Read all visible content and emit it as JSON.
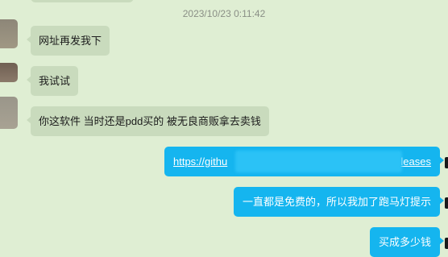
{
  "chat": {
    "timestamp": "2023/10/23 0:11:42",
    "messages": [
      {
        "side": "incoming",
        "text": "网址再发我下"
      },
      {
        "side": "incoming",
        "text": "我试试"
      },
      {
        "side": "incoming",
        "text": "你这软件 当时还是pdd买的 被无良商贩拿去卖钱"
      },
      {
        "side": "outgoing",
        "text": "https://github.com/releases",
        "link_prefix": "https://githu",
        "link_suffix": "leases"
      },
      {
        "side": "outgoing",
        "text": "一直都是免费的，所以我加了跑马灯提示"
      },
      {
        "side": "outgoing",
        "text": "买成多少钱"
      }
    ]
  },
  "colors": {
    "background": "#dfeed3",
    "incoming_bubble": "#c9dbbd",
    "outgoing_bubble": "#15b5ef"
  }
}
